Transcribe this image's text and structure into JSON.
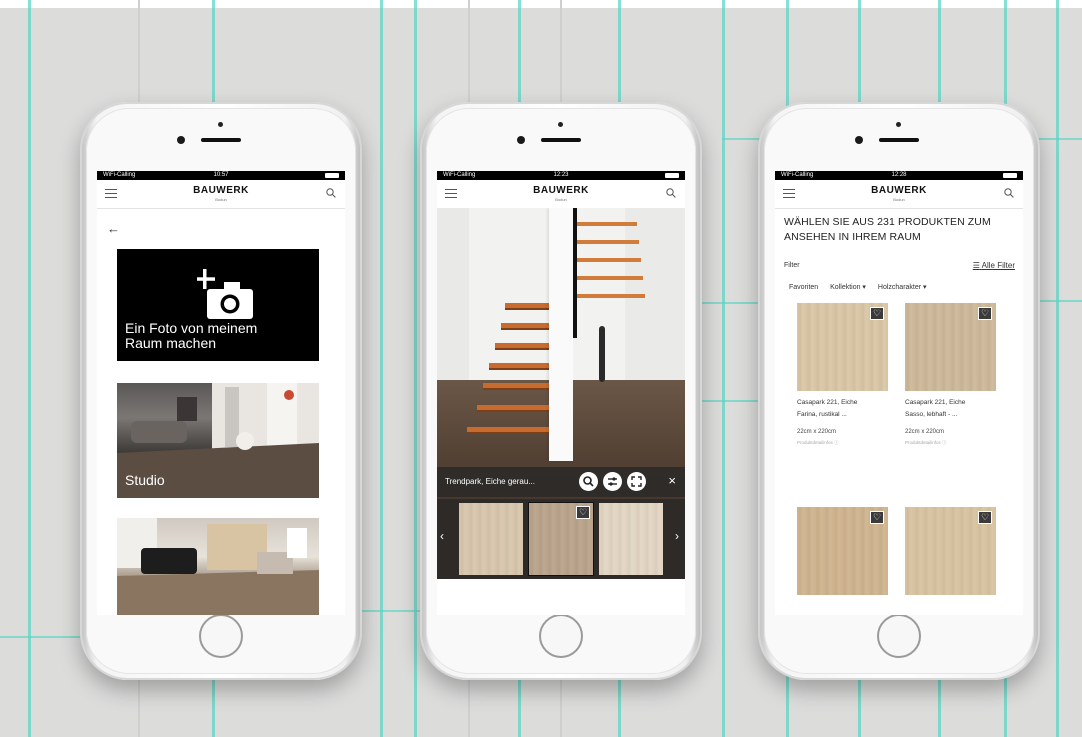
{
  "colors": {
    "accent_tile": "#5fd6c4",
    "brand_black": "#000000",
    "wood_orange": "#c86b2e"
  },
  "phone1": {
    "status": {
      "carrier": "WiFi-Calling",
      "time": "10:57"
    },
    "header": {
      "logo": "BAUWERK",
      "logo_sub": "Bodun"
    },
    "back_icon": "arrow-left-icon",
    "photo_card": {
      "line1": "Ein Foto von meinem",
      "line2": "Raum machen",
      "icon": "camera-plus-icon"
    },
    "studio_card": {
      "label": "Studio"
    }
  },
  "phone2": {
    "status": {
      "carrier": "WiFi-Calling",
      "time": "12:23"
    },
    "header": {
      "logo": "BAUWERK",
      "logo_sub": "Bodun"
    },
    "toolbar": {
      "product_name": "Trendpark, Eiche gerau...",
      "close": "×"
    },
    "swatch_colors": [
      "#d8c6ad",
      "#b9a48b",
      "#e2d5c2"
    ]
  },
  "phone3": {
    "status": {
      "carrier": "WiFi-Calling",
      "time": "12:28"
    },
    "header": {
      "logo": "BAUWERK",
      "logo_sub": "Bodun"
    },
    "title": "WÄHLEN SIE AUS 231 PRODUKTEN ZUM ANSEHEN IN IHREM RAUM",
    "filter_label": "Filter",
    "all_filters": "Alle Filter",
    "chips": [
      "Favoriten",
      "Kollektion ▾",
      "Holzcharakter ▾"
    ],
    "products": [
      {
        "name1": "Casapark 221, Eiche",
        "name2": "Farina, rustikal ...",
        "size": "22cm x 220cm",
        "sub": "Produktdetailinfos ⓘ",
        "color": "#d9c6a6"
      },
      {
        "name1": "Casapark 221, Eiche",
        "name2": "Sasso, lebhaft - ...",
        "size": "22cm x 220cm",
        "sub": "Produktdetailinfos ⓘ",
        "color": "#cdb899"
      },
      {
        "color": "#cfb48e"
      },
      {
        "color": "#d8c3a0"
      }
    ]
  }
}
